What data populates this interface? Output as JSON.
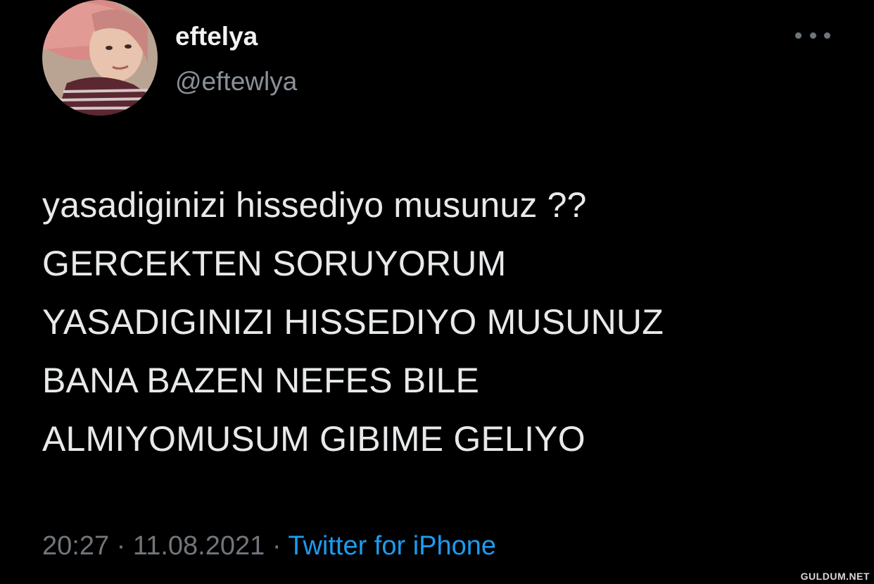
{
  "user": {
    "display_name": "eftelya",
    "handle": "@eftewlya"
  },
  "tweet": {
    "lines": [
      "yasadiginizi hissediyo musunuz ??",
      "GERCEKTEN SORUYORUM",
      "YASADIGINIZI HISSEDIYO MUSUNUZ",
      "BANA BAZEN NEFES BILE",
      "ALMIYOMUSUM GIBIME GELIYO"
    ]
  },
  "meta": {
    "time": "20:27",
    "date": "11.08.2021",
    "separator": "·",
    "source": "Twitter for iPhone"
  },
  "icons": {
    "more": "more-options-icon",
    "avatar": "profile-photo"
  },
  "colors": {
    "background": "#000000",
    "text": "#e7e9ea",
    "secondary": "#71767b",
    "link": "#1d9bf0"
  },
  "watermark": "GULDUM.NET"
}
